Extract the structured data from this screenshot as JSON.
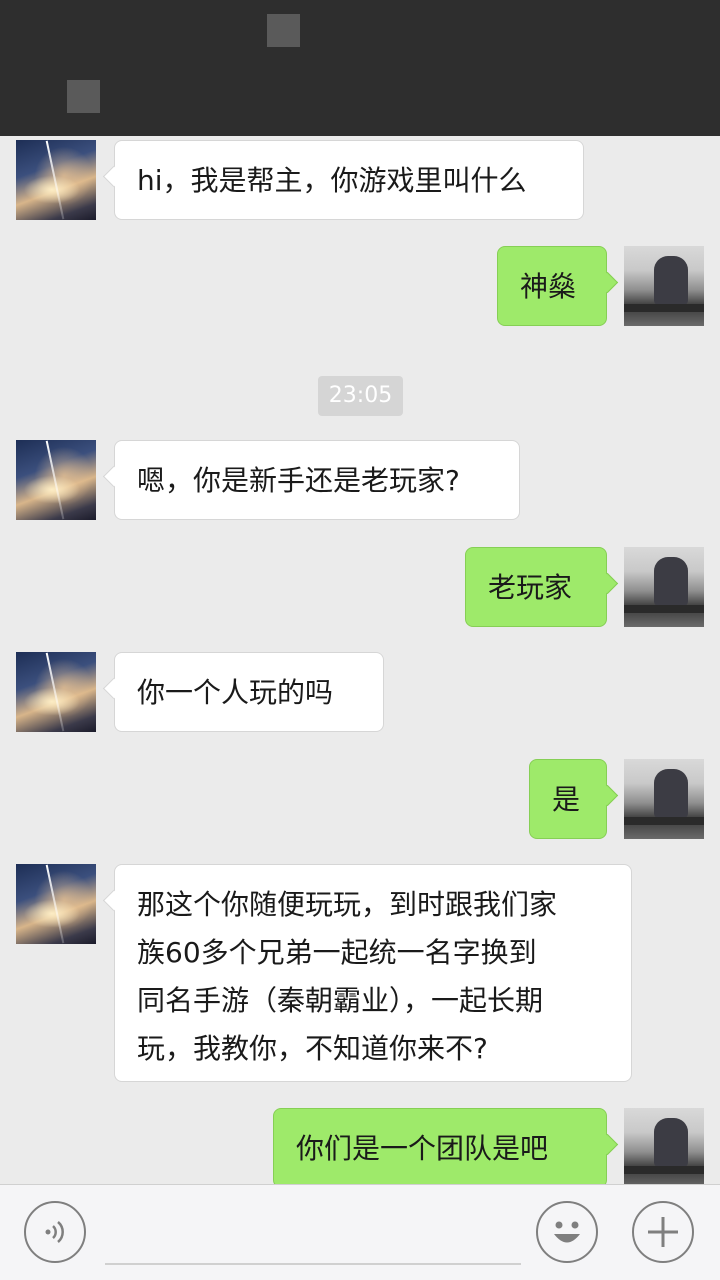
{
  "header": {
    "title": ""
  },
  "messages": [
    {
      "side": "left",
      "text": "hi，我是帮主，你游戏里叫什么"
    },
    {
      "side": "right",
      "text": "神燊"
    },
    {
      "type": "time",
      "text": "23:05"
    },
    {
      "side": "left",
      "text": "嗯，你是新手还是老玩家?"
    },
    {
      "side": "right",
      "text": "老玩家"
    },
    {
      "side": "left",
      "text": "你一个人玩的吗"
    },
    {
      "side": "right",
      "text": "是"
    },
    {
      "side": "left",
      "text": "那这个你随便玩玩，到时跟我们家\n族60多个兄弟一起统一名字换到\n同名手游（秦朝霸业），一起长期\n玩，我教你，不知道你来不?"
    },
    {
      "side": "right",
      "text": "你们是一个团队是吧"
    }
  ],
  "input": {
    "placeholder": ""
  },
  "icons": {
    "voice": "voice-icon",
    "emoji": "emoji-icon",
    "plus": "plus-icon"
  },
  "colors": {
    "header_bg": "#2e2e2e",
    "chat_bg": "#ebebeb",
    "outgoing_bubble": "#9eea6a",
    "incoming_bubble": "#ffffff"
  }
}
